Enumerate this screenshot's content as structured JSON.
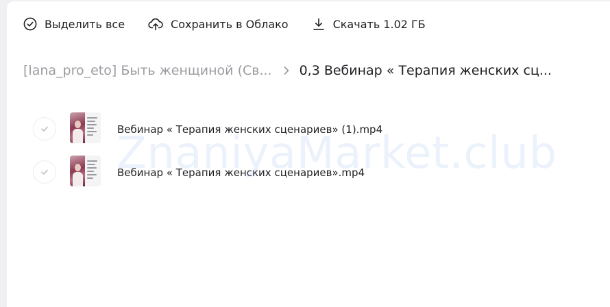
{
  "toolbar": {
    "select_all": {
      "label": "Выделить все",
      "icon": "check-circle-icon"
    },
    "save_cloud": {
      "label": "Сохранить в Облако",
      "icon": "cloud-upload-icon"
    },
    "download": {
      "label": "Скачать 1.02 ГБ",
      "icon": "download-icon"
    }
  },
  "breadcrumb": {
    "parent": "[lana_pro_eto] Быть женщиной (Св...",
    "separator_icon": "chevron-right-icon",
    "current": "0,3 Вебинар « Терапия женских сц..."
  },
  "files": [
    {
      "name": "Вебинар « Терапия женских сценариев» (1).mp4",
      "thumbnail": "video-thumbnail"
    },
    {
      "name": "Вебинар « Терапия женских сценариев».mp4",
      "thumbnail": "video-thumbnail"
    }
  ],
  "watermark": "ZnaniyaMarket.club",
  "colors": {
    "text": "#1f1f23",
    "muted": "#9b9ba1",
    "background": "#ffffff"
  }
}
